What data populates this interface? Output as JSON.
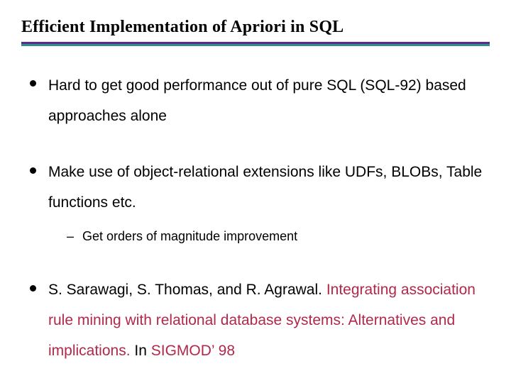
{
  "title": "Efficient Implementation of Apriori in SQL",
  "bullets": {
    "b1": "Hard to get good performance out of pure SQL (SQL-92) based approaches alone",
    "b2": "Make use of object-relational extensions like UDFs, BLOBs, Table functions etc.",
    "b2_sub1": "Get orders of magnitude improvement",
    "b3_authors": "S. Sarawagi, S. Thomas, and R. Agrawal. ",
    "b3_title": "Integrating association rule mining with relational database systems: Alternatives and implications. ",
    "b3_in": "In ",
    "b3_venue": "SIGMOD’ 98"
  }
}
